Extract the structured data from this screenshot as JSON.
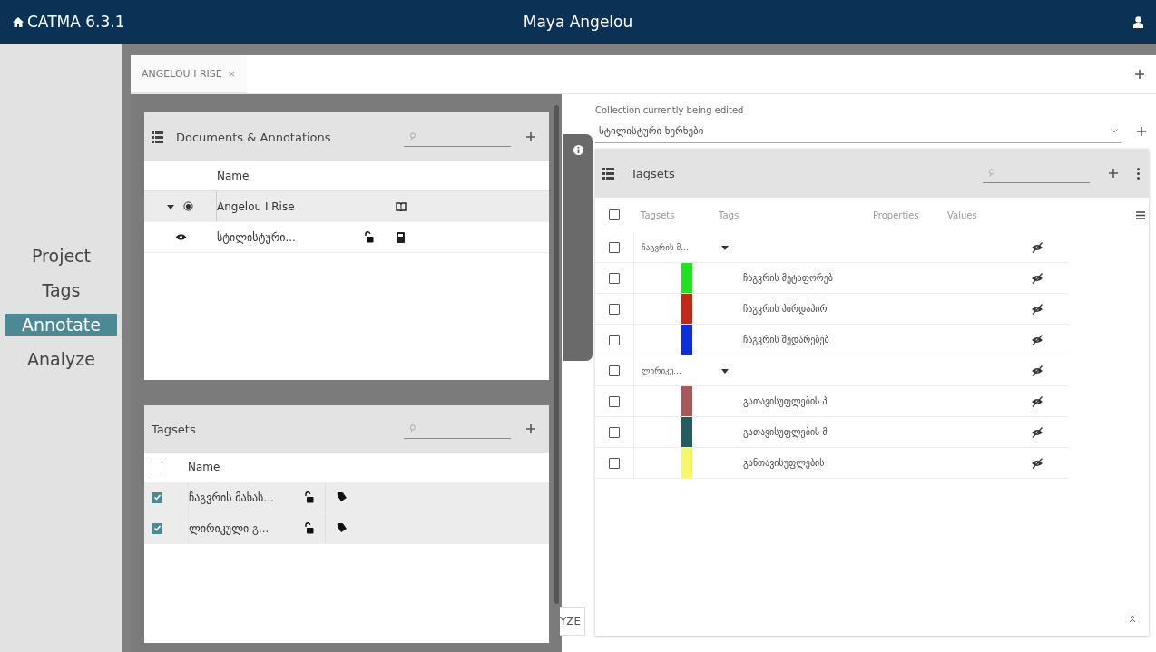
{
  "app": {
    "title": "CATMA 6.3.1",
    "user": "Maya Angelou"
  },
  "nav": [
    {
      "label": "Project",
      "selected": false
    },
    {
      "label": "Tags",
      "selected": false
    },
    {
      "label": "Annotate",
      "selected": true
    },
    {
      "label": "Analyze",
      "selected": false
    }
  ],
  "tabs": [
    {
      "label": "ANGELOU I RISE",
      "close": "×",
      "selected": true
    }
  ],
  "documents": {
    "title": "Documents & Annotations",
    "columns": [
      "Name"
    ],
    "rows": [
      {
        "name": "Angelou I Rise",
        "expanded": true,
        "selected": true,
        "children": [
          {
            "name": "სტილისტური...",
            "visible": true,
            "locked": false,
            "selected": false
          }
        ]
      }
    ]
  },
  "tagsets_panel": {
    "title": "Tagsets",
    "all_checked": false,
    "columns": [
      "Name"
    ],
    "rows": [
      {
        "name": "ჩაგვრის მახას...",
        "checked": true,
        "locked": false
      },
      {
        "name": "ლირიკული გ...",
        "checked": true,
        "locked": false
      }
    ]
  },
  "analyze_button": {
    "label": "YZE"
  },
  "collection": {
    "label": "Collection currently being edited",
    "value": "სტილისტური ხერხები"
  },
  "tagsets_table": {
    "title": "Tagsets",
    "all_checked": false,
    "columns": [
      "Tagsets",
      "Tags",
      "Properties",
      "Values"
    ],
    "rows": [
      {
        "name": "ჩაგვრის მ...",
        "checked": false,
        "expanded": true,
        "visible": false,
        "children": [
          {
            "name": "ჩაგვრის მეტაფორებ",
            "color": "#22e022",
            "checked": false,
            "visible": false
          },
          {
            "name": "ჩაგვრის პირდაპირ",
            "color": "#c02a18",
            "checked": false,
            "visible": false
          },
          {
            "name": "ჩაგვრის შედარებებ",
            "color": "#0b2fd8",
            "checked": false,
            "visible": false
          }
        ]
      },
      {
        "name": "ლირიკუ...",
        "checked": false,
        "expanded": true,
        "visible": false,
        "children": [
          {
            "name": "გათავისუფლების პ",
            "color": "#a85858",
            "checked": false,
            "visible": false
          },
          {
            "name": "გათავისუფლების მ",
            "color": "#235d5f",
            "checked": false,
            "visible": false
          },
          {
            "name": "განთავისუფლების",
            "color": "#f7f76a",
            "checked": false,
            "visible": false
          }
        ]
      }
    ]
  }
}
